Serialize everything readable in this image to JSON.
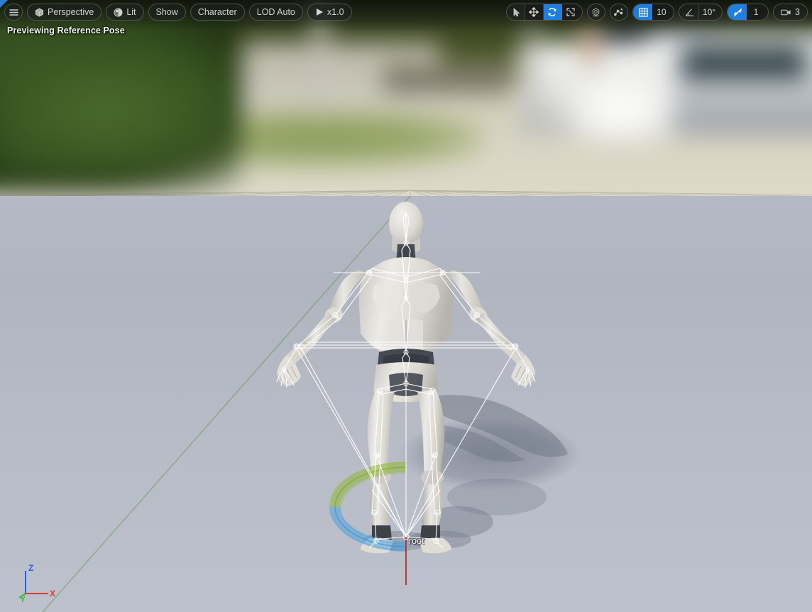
{
  "viewport": {
    "status_text": "Previewing Reference Pose",
    "focus_indicator": "viewport-focus-triangle"
  },
  "toolbar": {
    "left": [
      {
        "name": "viewport-menu",
        "icon": "hamburger-menu-icon",
        "label": ""
      },
      {
        "name": "view-mode",
        "icon": "cube-icon",
        "label": "Perspective"
      },
      {
        "name": "lighting-mode",
        "icon": "lighting-sphere-icon",
        "label": "Lit"
      },
      {
        "name": "show-menu",
        "icon": "",
        "label": "Show"
      },
      {
        "name": "character-menu",
        "icon": "",
        "label": "Character"
      },
      {
        "name": "lod-menu",
        "icon": "",
        "label": "LOD Auto"
      },
      {
        "name": "playback-speed",
        "icon": "play-icon",
        "label": "x1.0"
      }
    ],
    "right": {
      "transform_modes": [
        {
          "name": "select-mode",
          "icon": "cursor-arrow-icon",
          "active": false
        },
        {
          "name": "translate-mode",
          "icon": "move-arrows-icon",
          "active": false
        },
        {
          "name": "rotate-mode",
          "icon": "rotate-arrows-icon",
          "active": true
        },
        {
          "name": "scale-mode",
          "icon": "scale-arrows-icon",
          "active": false
        }
      ],
      "coordinate_system": {
        "name": "world-coordinates",
        "icon": "world-axis-icon"
      },
      "surface_snap": {
        "name": "surface-snapping",
        "icon": "surface-snap-icon"
      },
      "grid_snap": {
        "name": "grid-snap",
        "icon": "grid-icon",
        "active": true,
        "value": "10"
      },
      "angle_snap": {
        "name": "angle-snap",
        "icon": "angle-icon",
        "active": false,
        "value": "10°"
      },
      "scale_snap": {
        "name": "scale-snap",
        "icon": "scale-diagonal-icon",
        "active": true,
        "value": "1"
      },
      "camera_speed": {
        "name": "camera-speed",
        "icon": "camera-icon",
        "value": "3"
      }
    }
  },
  "scene": {
    "selected_bone_label": "root",
    "axis_indicator": {
      "z": "Z",
      "x": "X",
      "y": "Y"
    },
    "gizmo": {
      "type": "rotation-gizmo",
      "arc_upper_color": "#9ac13c",
      "arc_lower_color": "#4da2dd",
      "axis_line_color": "#b03222"
    }
  },
  "colors": {
    "accent_blue": "#1f7fe0",
    "axis_x": "#e03b2e",
    "axis_y": "#2fbf3a",
    "axis_z": "#2b5fe8",
    "skeleton": "#ffffff",
    "floor": "#b4b9c3",
    "toolbar_pill": "#1e201e"
  }
}
